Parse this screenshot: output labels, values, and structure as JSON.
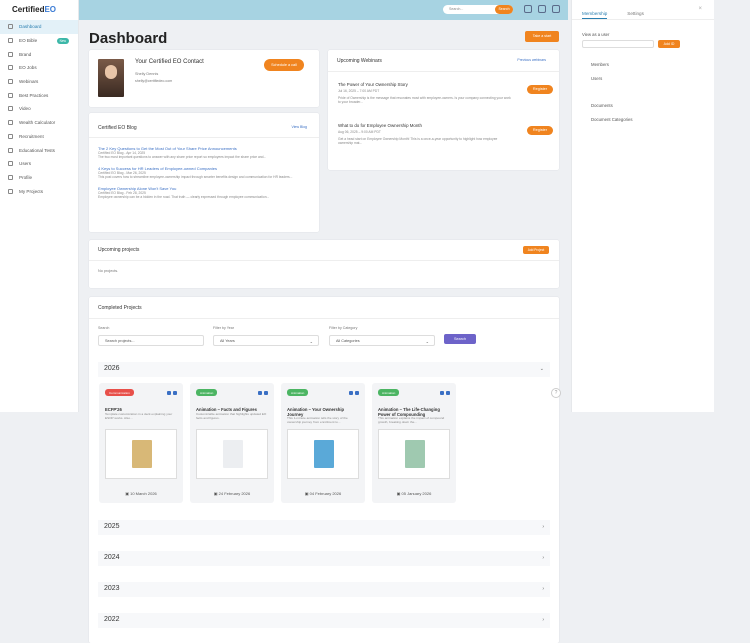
{
  "app": {
    "logo_main": "Certified",
    "logo_accent": "EO"
  },
  "sidebar": {
    "items": [
      {
        "label": "Dashboard",
        "icon": "dashboard-icon",
        "active": true
      },
      {
        "label": "EO Bible",
        "icon": "book-icon",
        "badge": "New"
      },
      {
        "label": "Brand",
        "icon": "pin-icon"
      },
      {
        "label": "EO Jobs",
        "icon": "briefcase-icon"
      },
      {
        "label": "Webinars",
        "icon": "calendar-icon"
      },
      {
        "label": "Best Practices",
        "icon": "star-icon"
      },
      {
        "label": "Video",
        "icon": "video-icon"
      },
      {
        "label": "Wealth Calculator",
        "icon": "calculator-icon"
      },
      {
        "label": "Recruitment",
        "icon": "recruit-icon"
      },
      {
        "label": "Educational Tests",
        "icon": "test-icon"
      },
      {
        "label": "Users",
        "icon": "users-icon"
      },
      {
        "label": "Profile",
        "icon": "profile-icon"
      },
      {
        "label": "My Projects",
        "icon": "folder-icon"
      }
    ]
  },
  "header": {
    "search_placeholder": "Search...",
    "search_button": "Search"
  },
  "main": {
    "page_title": "Dashboard",
    "take_start_button": "Take a start",
    "contact": {
      "title": "Your Certified EO Contact",
      "name": "Shelly Dennis",
      "email": "shelly@certifiedeo.com",
      "schedule_button": "Schedule a call"
    },
    "blog": {
      "title": "Certified EO Blog",
      "view_blog": "View Blog",
      "posts": [
        {
          "title": "The 2 Key Questions to Get the Most Out of Your Share Price Announcements",
          "meta": "Certified EO Blog - Apr 14, 2025",
          "excerpt": "The two most important questions to answer with any share price report so employees impact the share price and..."
        },
        {
          "title": "4 Keys to Success for HR Leaders of Employee-owned Companies",
          "meta": "Certified EO Blog - Mar 26, 2025",
          "excerpt": "This post covers how to streamline employee-ownership impact through smarter benefits design and communication for HR leaders..."
        },
        {
          "title": "Employee Ownership Alone Won't Save You",
          "meta": "Certified EO Blog - Feb 28, 2025",
          "excerpt": "Employee ownership can be a hidden in the road. That truth — clearly expressed through employee communication..."
        }
      ]
    },
    "webinars": {
      "title": "Upcoming Webinars",
      "previous_link": "Previous webinars",
      "items": [
        {
          "title": "The Power of Your Ownership Story",
          "date": "Jul 16, 2025 – 7:00 AM PDT",
          "desc": "Pride of Ownership is the message that resonates most with employee-owners. Is your company connecting your work to your broader...",
          "button": "Register"
        },
        {
          "title": "What to do for Employee Ownership Month",
          "date": "Aug 06, 2025 – 9:00 AM PDT",
          "desc": "Get a head start on Employee Ownership Month! This is a once-a-year opportunity to highlight how employee ownership mat...",
          "button": "Register"
        }
      ]
    },
    "upcoming_projects": {
      "title": "Upcoming projects",
      "add_button": "Add Project",
      "empty_text": "No projects."
    },
    "completed": {
      "title": "Completed Projects",
      "search_label": "Search",
      "search_placeholder": "Search projects...",
      "year_label": "Filter by Year",
      "year_value": "All Years",
      "category_label": "Filter by Category",
      "category_value": "All Categories",
      "search_button": "Search",
      "years": [
        "2026",
        "2025",
        "2024",
        "2023",
        "2022"
      ],
      "projects": [
        {
          "tag": "Communication",
          "tag_color": "#e8504a",
          "title": "ECFP'26",
          "desc": "Template customization in a deck explaining your ESOP works. Also...",
          "date": "10 March 2026"
        },
        {
          "tag": "Animation",
          "tag_color": "#4cb563",
          "title": "Animation – Facts and Figures",
          "desc": "Customizable animation that highlights updated EO facts and figures.",
          "date": "24 February 2026"
        },
        {
          "tag": "Animation",
          "tag_color": "#4cb563",
          "title": "Animation – Your Ownership Journey",
          "desc": "This 1-minute animation tells the story of the ownership journey from enrollment to...",
          "date": "04 February 2026"
        },
        {
          "tag": "Animation",
          "tag_color": "#4cb563",
          "title": "Animation – The Life-Changing Power of Compounding",
          "desc": "This animation explains the impact of compound growth, breaking down the...",
          "date": "05 January 2026"
        }
      ]
    }
  },
  "right_panel": {
    "tab_membership": "Membership",
    "tab_settings": "Settings",
    "add_user_label": "View as a user",
    "add_button": "Add ID",
    "links_top": [
      "Members",
      "Users"
    ],
    "links_bottom": [
      "Documents",
      "Document Categories"
    ]
  }
}
